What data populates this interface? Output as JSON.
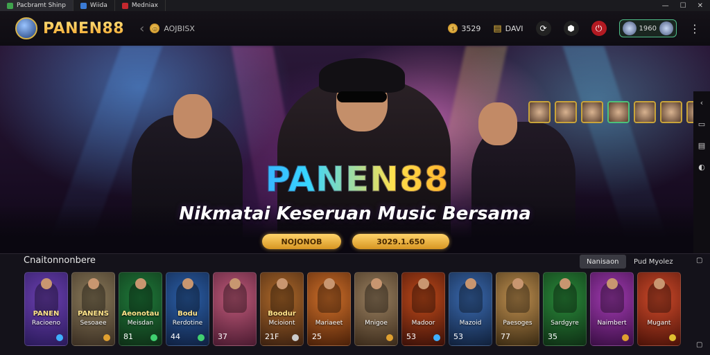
{
  "browser": {
    "tabs": [
      {
        "label": "Pacbramt Shinp",
        "color": "#3fa34d"
      },
      {
        "label": "Wiida",
        "color": "#3a7bd5"
      },
      {
        "label": "Medniax",
        "color": "#c4282e"
      }
    ]
  },
  "header": {
    "brand": "PANEN88",
    "nav_label": "AOJBISX",
    "coins_value": "3529",
    "bag_value": "DAVI",
    "profile_value": "1960"
  },
  "hero": {
    "brand": "PANEN88",
    "tagline": "Nikmatai Keseruan Music Bersama",
    "button1": "NOJONOB",
    "button2": "3029.1.650"
  },
  "games": {
    "title": "Cnaitonnonbere",
    "filter_active": "Nanisaon",
    "filter_other": "Pud Myolez",
    "cards": [
      {
        "title": "PANEN",
        "sub": "Racioeno",
        "num": "",
        "bg": "#6b3fb0",
        "bg2": "#2a1a5a",
        "dot": "#3fb0ff"
      },
      {
        "title": "PANENS",
        "sub": "Sesoaee",
        "num": "",
        "bg": "#8a7a5a",
        "bg2": "#3a2e22",
        "dot": "#e0a030"
      },
      {
        "title": "Aeonotau",
        "sub": "Meisdan",
        "num": "81",
        "bg": "#1f7a3a",
        "bg2": "#0e2e16",
        "dot": "#40d070"
      },
      {
        "title": "Bodu",
        "sub": "Rerdotine",
        "num": "44",
        "bg": "#2b5fa8",
        "bg2": "#0f2040",
        "dot": "#40d070"
      },
      {
        "title": "",
        "sub": "",
        "num": "37",
        "bg": "#c05a7a",
        "bg2": "#4a1a30",
        "dot": ""
      },
      {
        "title": "Boodur",
        "sub": "Mcioiont",
        "num": "21F",
        "bg": "#b06a2a",
        "bg2": "#3a2010",
        "dot": "#cccccc"
      },
      {
        "title": "",
        "sub": "Mariaeet",
        "num": "25",
        "bg": "#d0702a",
        "bg2": "#4a2008",
        "dot": ""
      },
      {
        "title": "",
        "sub": "Mnigoe",
        "num": "",
        "bg": "#9a8060",
        "bg2": "#3a2a1a",
        "dot": "#e0a030"
      },
      {
        "title": "",
        "sub": "Madoor",
        "num": "53",
        "bg": "#c04a1a",
        "bg2": "#3a1008",
        "dot": "#3fb0ff"
      },
      {
        "title": "",
        "sub": "Mazoid",
        "num": "53",
        "bg": "#3a6ab0",
        "bg2": "#10203a",
        "dot": ""
      },
      {
        "title": "",
        "sub": "Paesoges",
        "num": "77",
        "bg": "#c09050",
        "bg2": "#3a2a12",
        "dot": ""
      },
      {
        "title": "",
        "sub": "Sardgyre",
        "num": "35",
        "bg": "#2a8a3a",
        "bg2": "#0e2e14",
        "dot": ""
      },
      {
        "title": "",
        "sub": "Naimbert",
        "num": "",
        "bg": "#a03ab0",
        "bg2": "#3a0e44",
        "dot": "#e0a030"
      },
      {
        "title": "",
        "sub": "Mugant",
        "num": "",
        "bg": "#d04a2a",
        "bg2": "#4a1208",
        "dot": "#e0c030"
      }
    ]
  },
  "colors": {
    "accent_gold": "#f0b030",
    "brand_blue": "#37d6ff",
    "background": "#0d0a12"
  }
}
